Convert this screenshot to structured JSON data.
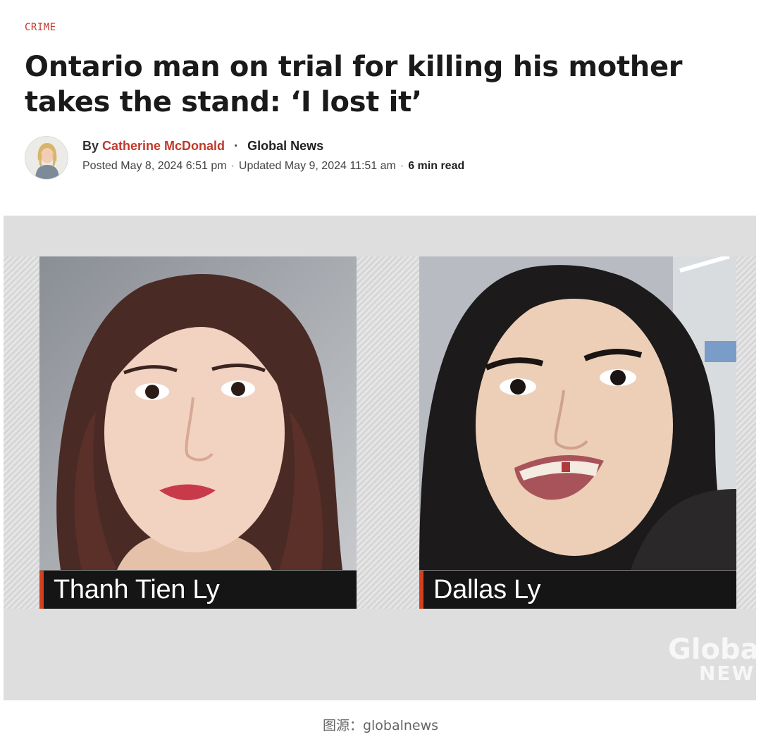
{
  "article": {
    "category": "CRIME",
    "headline": "Ontario man on trial for killing his mother takes the stand: ‘I lost it’",
    "byline": {
      "by": "By",
      "author": "Catherine McDonald",
      "dot": "·",
      "outlet": "Global News",
      "posted": "Posted May 8, 2024 6:51 pm",
      "separator": "·",
      "updated": "Updated May 9, 2024 11:51 am",
      "read_time": "6 min read"
    }
  },
  "image": {
    "left_name": "Thanh Tien Ly",
    "right_name": "Dallas Ly",
    "watermark_top": "Globa",
    "watermark_bottom": "NEW",
    "accent_color": "#d2401f"
  },
  "caption": "图源：globalnews",
  "colors": {
    "category": "#c0392b",
    "author_link": "#c0392b",
    "nameplate_bg": "#151515"
  }
}
